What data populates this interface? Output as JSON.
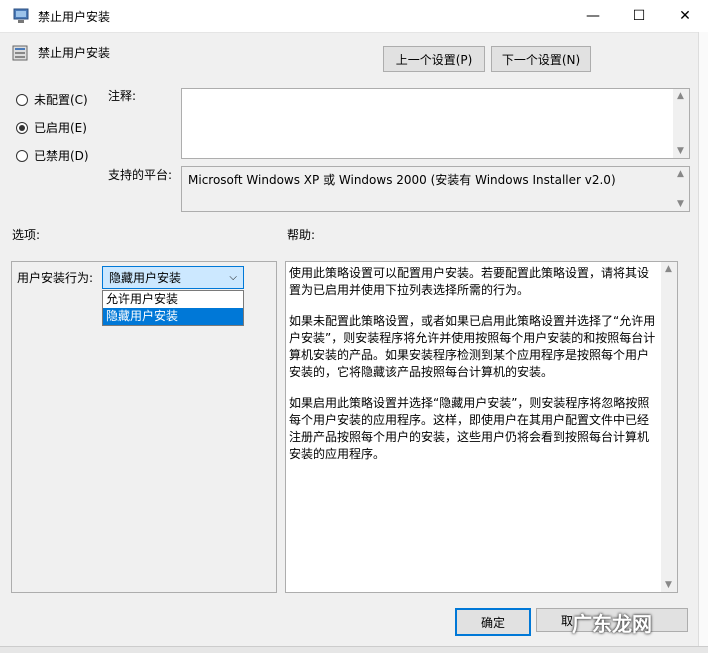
{
  "window": {
    "title": "禁止用户安装",
    "minimize_glyph": "—",
    "maximize_glyph": "☐",
    "close_glyph": "✕"
  },
  "header": {
    "policy_name": "禁止用户安装",
    "prev_button": "上一个设置(P)",
    "next_button": "下一个设置(N)"
  },
  "radios": {
    "not_configured": "未配置(C)",
    "enabled": "已启用(E)",
    "disabled": "已禁用(D)",
    "selected": "enabled"
  },
  "labels": {
    "comment": "注释:",
    "supported": "支持的平台:",
    "options": "选项:",
    "help": "帮助:"
  },
  "comment_value": "",
  "supported_value": "Microsoft Windows XP 或 Windows 2000 (安装有 Windows Installer v2.0)",
  "options": {
    "behavior_label": "用户安装行为:",
    "dropdown_value": "隐藏用户安装",
    "dropdown_items": [
      "允许用户安装",
      "隐藏用户安装"
    ],
    "selected_index": 1
  },
  "help": {
    "paragraphs": [
      "使用此策略设置可以配置用户安装。若要配置此策略设置，请将其设置为已启用并使用下拉列表选择所需的行为。",
      "如果未配置此策略设置，或者如果已启用此策略设置并选择了“允许用户安装”，则安装程序将允许并使用按照每个用户安装的和按照每台计算机安装的产品。如果安装程序检测到某个应用程序是按照每个用户安装的，它将隐藏该产品按照每台计算机的安装。",
      "如果启用此策略设置并选择“隐藏用户安装”，则安装程序将忽略按照每个用户安装的应用程序。这样，即使用户在其用户配置文件中已经注册产品按照每个用户的安装，这些用户仍将会看到按照每台计算机安装的应用程序。"
    ]
  },
  "footer": {
    "ok_button": "确定",
    "cancel_button": "取"
  },
  "watermark": "广东龙网"
}
